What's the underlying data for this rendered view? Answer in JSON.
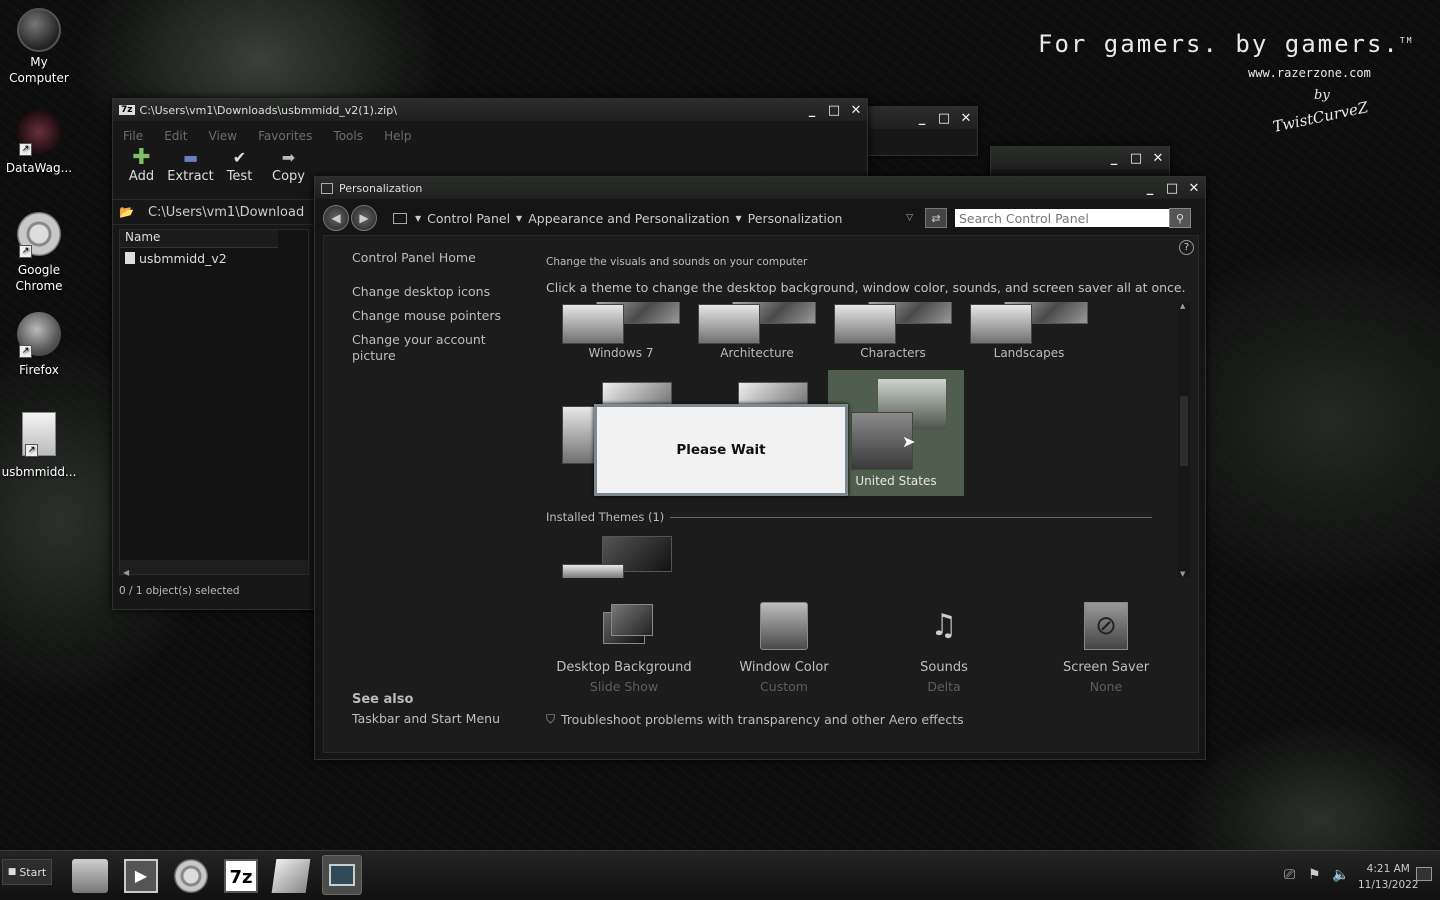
{
  "desktop_icons": [
    {
      "label": "My\nComputer",
      "icon": "computer-icon"
    },
    {
      "label": "DataWag...",
      "icon": "datawag-icon"
    },
    {
      "label": "Google\nChrome",
      "icon": "chrome-icon"
    },
    {
      "label": "Firefox",
      "icon": "firefox-icon"
    },
    {
      "label": "usbmmidd...",
      "icon": "folder-icon"
    }
  ],
  "branding": {
    "tagline": "For gamers. by gamers.",
    "tm": "TM",
    "url": "www.razerzone.com",
    "by": "by",
    "signature": "TwistCurveZ"
  },
  "zip_window": {
    "title": "C:\\Users\\vm1\\Downloads\\usbmmidd_v2(1).zip\\",
    "menu": [
      "File",
      "Edit",
      "View",
      "Favorites",
      "Tools",
      "Help"
    ],
    "toolbar": [
      {
        "label": "Add",
        "icon": "plus-icon"
      },
      {
        "label": "Extract",
        "icon": "minus-icon"
      },
      {
        "label": "Test",
        "icon": "check-icon"
      },
      {
        "label": "Copy",
        "icon": "arrow-right-icon"
      }
    ],
    "path": "C:\\Users\\vm1\\Download",
    "column_name": "Name",
    "files": [
      "usbmmidd_v2"
    ],
    "status": "0 / 1 object(s) selected"
  },
  "personalization": {
    "title": "Personalization",
    "breadcrumb": [
      "Control Panel",
      "Appearance and Personalization",
      "Personalization"
    ],
    "search_placeholder": "Search Control Panel",
    "sidebar": {
      "home": "Control Panel Home",
      "links": [
        "Change desktop icons",
        "Change mouse pointers",
        "Change your account picture"
      ],
      "see_also": "See also",
      "see_also_links": [
        "Taskbar and Start Menu"
      ]
    },
    "heading": "Change the visuals and sounds on your computer",
    "description": "Click a theme to change the desktop background, window color, sounds, and screen saver all at once.",
    "themes_row1": [
      "Windows 7",
      "Architecture",
      "Characters",
      "Landscapes"
    ],
    "selected_theme": "United States",
    "installed_header": "Installed Themes (1)",
    "please_wait": "Please Wait",
    "bottom": [
      {
        "label": "Desktop Background",
        "value": "Slide Show",
        "icon": "desktop-background-icon"
      },
      {
        "label": "Window Color",
        "value": "Custom",
        "icon": "window-color-icon"
      },
      {
        "label": "Sounds",
        "value": "Delta",
        "icon": "sounds-icon"
      },
      {
        "label": "Screen Saver",
        "value": "None",
        "icon": "screen-saver-icon"
      }
    ],
    "troubleshoot": "Troubleshoot problems with transparency and other Aero effects"
  },
  "taskbar": {
    "start": "Start",
    "time": "4:21 AM",
    "date": "11/13/2022"
  }
}
